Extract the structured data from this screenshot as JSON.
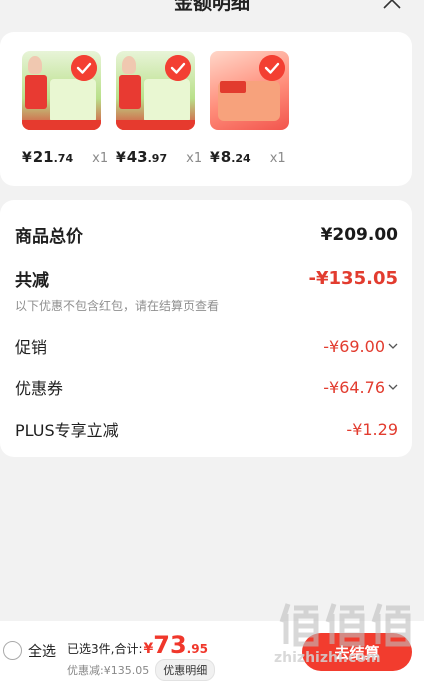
{
  "header": {
    "title": "金额明细"
  },
  "products": [
    {
      "price_yen": "¥",
      "price_int": "21",
      "price_dec": ".74",
      "qty": "x1"
    },
    {
      "price_yen": "¥",
      "price_int": "43",
      "price_dec": ".97",
      "qty": "x1"
    },
    {
      "price_yen": "¥",
      "price_int": "8",
      "price_dec": ".24",
      "qty": "x1"
    }
  ],
  "summary": {
    "total_label": "商品总价",
    "total_value": "¥209.00",
    "reduce_label": "共减",
    "reduce_value": "-¥135.05",
    "note": "以下优惠不包含红包，请在结算页查看",
    "promo_label": "促销",
    "promo_value": "-¥69.00",
    "coupon_label": "优惠券",
    "coupon_value": "-¥64.76",
    "plus_label": "PLUS专享立减",
    "plus_value": "-¥1.29"
  },
  "footer": {
    "select_all": "全选",
    "selected_text": "已选3件,合计:",
    "total_yen": "¥",
    "total_int": "73",
    "total_dec": ".95",
    "discount_text": "优惠减:¥135.05",
    "detail_label": "优惠明细",
    "checkout_label": "去结算"
  },
  "watermark": {
    "url": "zhizhizhi.com"
  },
  "colors": {
    "accent": "#f23c2e",
    "discount_text": "#e23c2f"
  }
}
